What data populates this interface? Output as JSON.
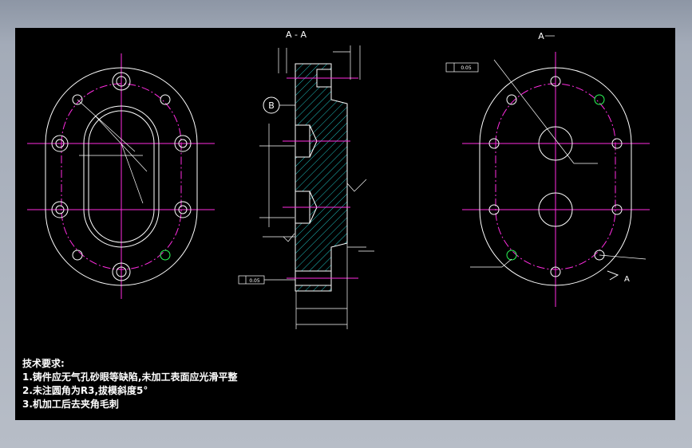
{
  "drawing": {
    "section_label": "A - A",
    "view_label": "A",
    "view_arrow_label": "A",
    "detail_label": "B",
    "tolerance_frame_left": "0.05",
    "tolerance_frame_right": "0.05"
  },
  "notes": {
    "heading": "技术要求:",
    "items": [
      "1.铸件应无气孔砂眼等缺陷,未加工表面应光滑平整",
      "2.未注圆角为R3,拔模斜度5°",
      "3.机加工后去夹角毛刺"
    ]
  },
  "colors": {
    "background": "#000000",
    "outline": "#ffffff",
    "center_lines": "#ff2ce0",
    "hatch": "#1fbfbf",
    "highlight": "#2cff59"
  }
}
